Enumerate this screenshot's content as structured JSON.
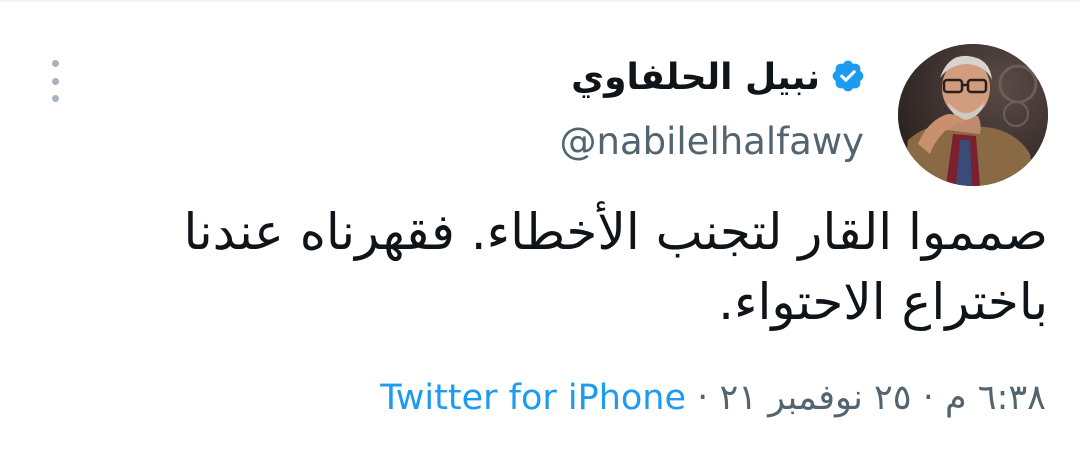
{
  "tweet": {
    "author": {
      "display_name": "نبيل الحلفاوي",
      "handle": "@nabilelhalfawy",
      "verified": true,
      "verified_color": "#1d9bf0"
    },
    "text_lines": [
      "صمموا القار لتجنب الأخطاء. فقهرناه عندنا",
      "باختراع الاحتواء."
    ],
    "meta": {
      "time": "٦:٣٨ م",
      "date": "٢٥ نوفمبر ٢١",
      "separator": "·",
      "source": "Twitter for iPhone"
    },
    "icons": {
      "more": "more-vertical-icon",
      "verified": "verified-badge-icon"
    }
  },
  "colors": {
    "text": "#0f1419",
    "secondary": "#536471",
    "link": "#1d9bf0",
    "more_dots": "#a7b4bf"
  }
}
